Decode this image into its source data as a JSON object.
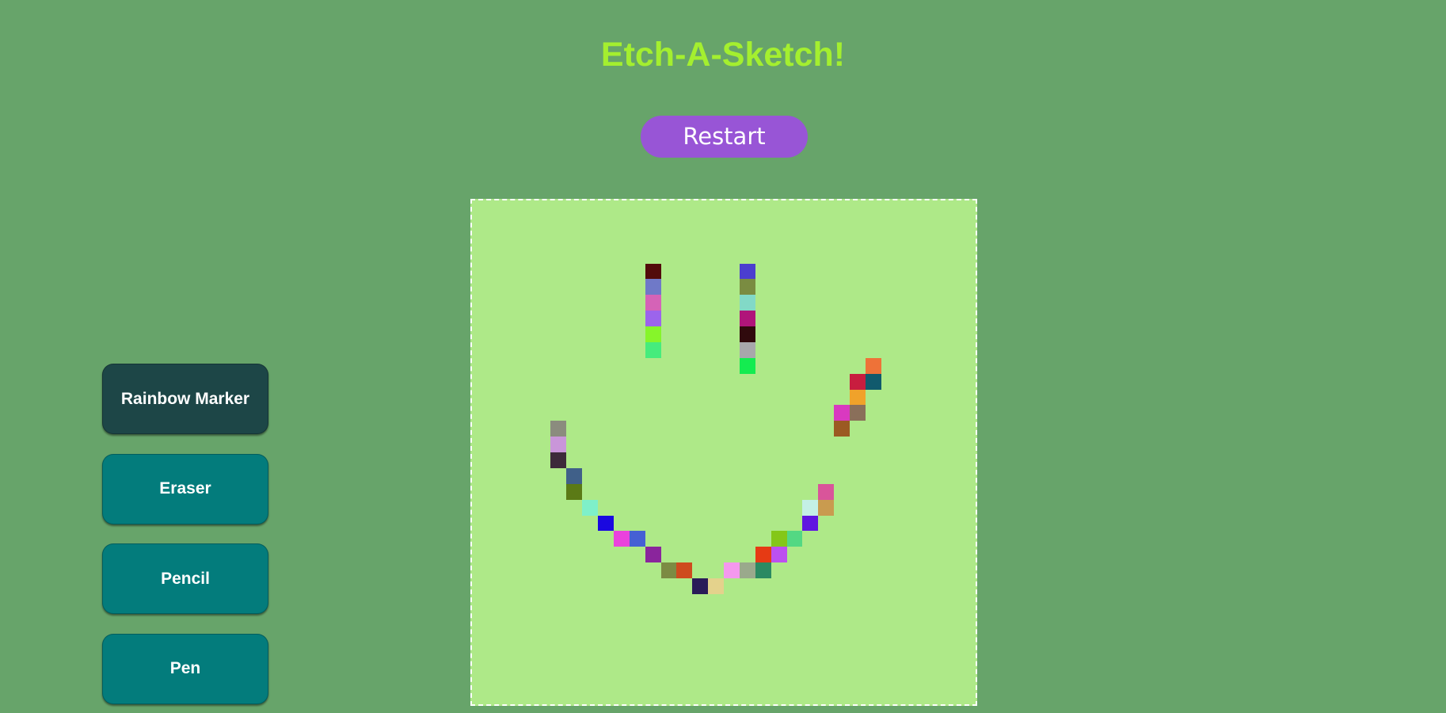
{
  "app": {
    "title": "Etch-A-Sketch!",
    "title_color": "#a4ef2f",
    "background_color": "#67a46a"
  },
  "restart": {
    "label": "Restart",
    "color": "#9855d6"
  },
  "tools": {
    "rainbow_marker": {
      "label": "Rainbow Marker",
      "selected": true
    },
    "eraser": {
      "label": "Eraser",
      "selected": false
    },
    "pencil": {
      "label": "Pencil",
      "selected": false
    },
    "pen": {
      "label": "Pen",
      "selected": false
    },
    "selected_color": "#1d4647",
    "default_color": "#037c7c"
  },
  "board": {
    "grid_size": 32,
    "background_color": "#aee988",
    "border_color": "#ffffff",
    "painted_cells": [
      {
        "row": 4,
        "col": 11,
        "color": "#520b0b"
      },
      {
        "row": 5,
        "col": 11,
        "color": "#6f79c8"
      },
      {
        "row": 6,
        "col": 11,
        "color": "#d563b7"
      },
      {
        "row": 7,
        "col": 11,
        "color": "#9c64ec"
      },
      {
        "row": 8,
        "col": 11,
        "color": "#86f52a"
      },
      {
        "row": 9,
        "col": 11,
        "color": "#46ec7c"
      },
      {
        "row": 4,
        "col": 17,
        "color": "#4b3ecf"
      },
      {
        "row": 5,
        "col": 17,
        "color": "#7a8c41"
      },
      {
        "row": 6,
        "col": 17,
        "color": "#82d9c7"
      },
      {
        "row": 7,
        "col": 17,
        "color": "#b0157a"
      },
      {
        "row": 8,
        "col": 17,
        "color": "#300a0d"
      },
      {
        "row": 9,
        "col": 17,
        "color": "#a8a7ab"
      },
      {
        "row": 10,
        "col": 17,
        "color": "#14ec50"
      },
      {
        "row": 10,
        "col": 25,
        "color": "#ee7238"
      },
      {
        "row": 11,
        "col": 24,
        "color": "#c81d3f"
      },
      {
        "row": 11,
        "col": 25,
        "color": "#115a6d"
      },
      {
        "row": 12,
        "col": 24,
        "color": "#f0a22a"
      },
      {
        "row": 13,
        "col": 23,
        "color": "#d939c0"
      },
      {
        "row": 13,
        "col": 24,
        "color": "#8a6f5a"
      },
      {
        "row": 14,
        "col": 23,
        "color": "#9b5a22"
      },
      {
        "row": 14,
        "col": 5,
        "color": "#8b8c7e"
      },
      {
        "row": 15,
        "col": 5,
        "color": "#c996d9"
      },
      {
        "row": 16,
        "col": 5,
        "color": "#3d2b3a"
      },
      {
        "row": 17,
        "col": 6,
        "color": "#406089"
      },
      {
        "row": 18,
        "col": 6,
        "color": "#5b7a16"
      },
      {
        "row": 19,
        "col": 7,
        "color": "#7ef0c9"
      },
      {
        "row": 20,
        "col": 8,
        "color": "#1a08e0"
      },
      {
        "row": 21,
        "col": 9,
        "color": "#ea42dd"
      },
      {
        "row": 21,
        "col": 10,
        "color": "#4560d4"
      },
      {
        "row": 22,
        "col": 11,
        "color": "#8a259c"
      },
      {
        "row": 23,
        "col": 12,
        "color": "#7c8b43"
      },
      {
        "row": 23,
        "col": 13,
        "color": "#ce4b1e"
      },
      {
        "row": 24,
        "col": 14,
        "color": "#2a1b58"
      },
      {
        "row": 24,
        "col": 15,
        "color": "#e4d28c"
      },
      {
        "row": 23,
        "col": 16,
        "color": "#f498ee"
      },
      {
        "row": 23,
        "col": 17,
        "color": "#9aa98c"
      },
      {
        "row": 23,
        "col": 18,
        "color": "#2b8a62"
      },
      {
        "row": 22,
        "col": 18,
        "color": "#e63a14"
      },
      {
        "row": 22,
        "col": 19,
        "color": "#bc50f0"
      },
      {
        "row": 21,
        "col": 19,
        "color": "#84c718"
      },
      {
        "row": 21,
        "col": 20,
        "color": "#53d883"
      },
      {
        "row": 20,
        "col": 21,
        "color": "#6016e0"
      },
      {
        "row": 19,
        "col": 21,
        "color": "#c4f0e6"
      },
      {
        "row": 19,
        "col": 22,
        "color": "#c99b4f"
      },
      {
        "row": 18,
        "col": 22,
        "color": "#d9559a"
      }
    ]
  }
}
